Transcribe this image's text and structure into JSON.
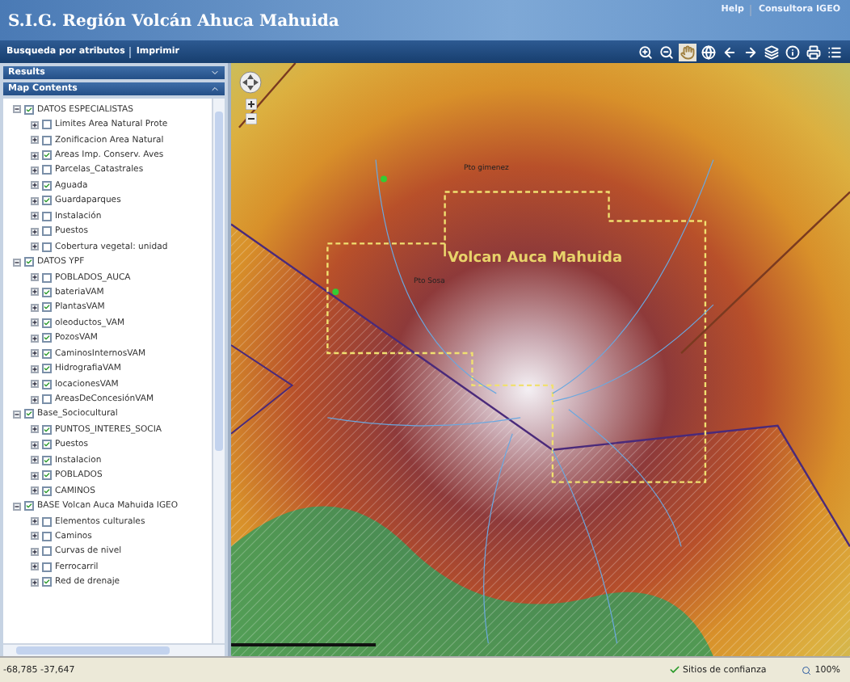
{
  "header": {
    "title": "S.I.G. Región Volcán Ahuca Mahuida",
    "links": [
      "Help",
      "Consultora IGEO"
    ]
  },
  "toolbar": {
    "links": [
      "Busqueda por atributos",
      "Imprimir"
    ],
    "tools": [
      {
        "kind": "zoomin",
        "selected": false
      },
      {
        "kind": "zoomout",
        "selected": false
      },
      {
        "kind": "pan",
        "selected": true
      },
      {
        "kind": "globe",
        "selected": false
      },
      {
        "kind": "back",
        "selected": false
      },
      {
        "kind": "forward",
        "selected": false
      },
      {
        "kind": "layers",
        "selected": false
      },
      {
        "kind": "info",
        "selected": false
      },
      {
        "kind": "print",
        "selected": false
      },
      {
        "kind": "legend",
        "selected": false
      }
    ]
  },
  "panels": [
    {
      "title": "Results",
      "expanded": false
    },
    {
      "title": "Map Contents",
      "expanded": true
    }
  ],
  "layers": [
    {
      "label": "DATOS ESPECIALISTAS",
      "checked": true,
      "expanded": true,
      "children": [
        {
          "label": "Limites Area Natural Prote",
          "checked": false,
          "expanded": false
        },
        {
          "label": "Zonificacion Area Natural",
          "checked": false,
          "expanded": false
        },
        {
          "label": "Areas Imp. Conserv. Aves",
          "checked": true,
          "expanded": false
        },
        {
          "label": "Parcelas_Catastrales",
          "checked": false,
          "expanded": false
        },
        {
          "label": "Aguada",
          "checked": true,
          "expanded": false
        },
        {
          "label": "Guardaparques",
          "checked": true,
          "expanded": false
        },
        {
          "label": "Instalación",
          "checked": false,
          "expanded": false
        },
        {
          "label": "Puestos",
          "checked": false,
          "expanded": false
        },
        {
          "label": "Cobertura vegetal: unidad",
          "checked": false,
          "expanded": false
        }
      ]
    },
    {
      "label": "DATOS YPF",
      "checked": true,
      "expanded": true,
      "children": [
        {
          "label": "POBLADOS_AUCA",
          "checked": false,
          "expanded": false
        },
        {
          "label": "bateriaVAM",
          "checked": true,
          "expanded": false
        },
        {
          "label": "PlantasVAM",
          "checked": true,
          "expanded": false
        },
        {
          "label": "oleoductos_VAM",
          "checked": true,
          "expanded": false
        },
        {
          "label": "PozosVAM",
          "checked": true,
          "expanded": false
        },
        {
          "label": "CaminosInternosVAM",
          "checked": true,
          "expanded": false
        },
        {
          "label": "HidrografiaVAM",
          "checked": true,
          "expanded": false
        },
        {
          "label": "locacionesVAM",
          "checked": true,
          "expanded": false
        },
        {
          "label": "AreasDeConcesiónVAM",
          "checked": false,
          "expanded": false
        }
      ]
    },
    {
      "label": "Base_Sociocultural",
      "checked": true,
      "expanded": true,
      "children": [
        {
          "label": "PUNTOS_INTERES_SOCIA",
          "checked": true,
          "expanded": false
        },
        {
          "label": "Puestos",
          "checked": true,
          "expanded": false
        },
        {
          "label": "Instalacion",
          "checked": true,
          "expanded": false
        },
        {
          "label": "POBLADOS",
          "checked": true,
          "expanded": false
        },
        {
          "label": "CAMINOS",
          "checked": true,
          "expanded": false
        }
      ]
    },
    {
      "label": "BASE Volcan Auca Mahuida IGEO",
      "checked": true,
      "expanded": true,
      "children": [
        {
          "label": "Elementos culturales",
          "checked": false,
          "expanded": false
        },
        {
          "label": "Caminos",
          "checked": false,
          "expanded": false
        },
        {
          "label": "Curvas de nivel",
          "checked": false,
          "expanded": false
        },
        {
          "label": "Ferrocarril",
          "checked": false,
          "expanded": false
        },
        {
          "label": "Red de drenaje",
          "checked": true,
          "expanded": false
        }
      ]
    }
  ],
  "map": {
    "title_label": "Volcan Auca Mahuida",
    "place_labels": [
      "Pto gimenez",
      "Pto Sosa"
    ]
  },
  "status_bar": {
    "coordinates": "-68,785 -37,647",
    "zone": "Sitios de confianza",
    "zoom": "100%"
  }
}
